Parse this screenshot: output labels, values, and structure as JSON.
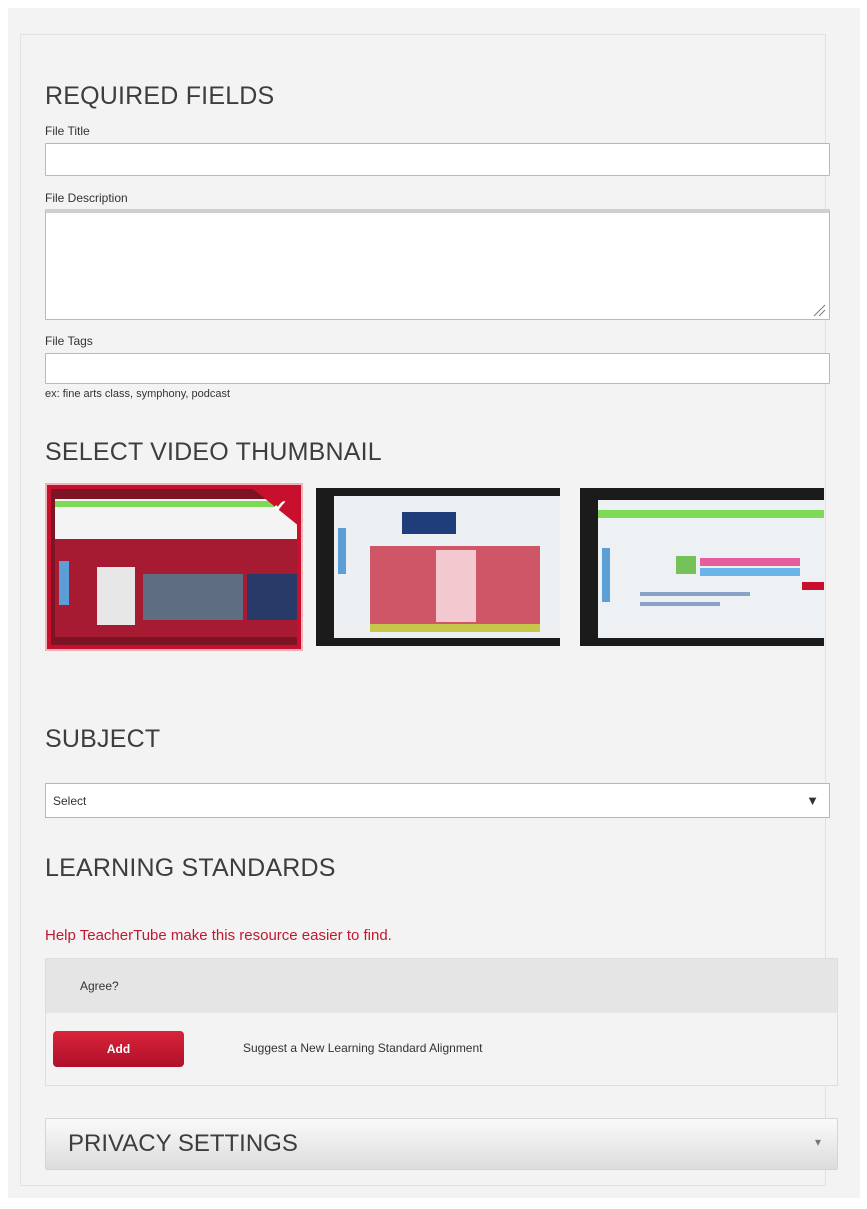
{
  "required_fields": {
    "title": "REQUIRED FIELDS",
    "file_title_label": "File Title",
    "file_title_value": "",
    "file_description_label": "File Description",
    "file_description_value": "",
    "file_tags_label": "File Tags",
    "file_tags_value": "",
    "file_tags_hint": "ex: fine arts class, symphony, podcast"
  },
  "thumbnails": {
    "title": "SELECT VIDEO THUMBNAIL",
    "items": [
      {
        "selected": true,
        "checkmark": "✔"
      },
      {
        "selected": false
      },
      {
        "selected": false
      }
    ]
  },
  "subject": {
    "title": "SUBJECT",
    "selected_option": "Select",
    "arrow": "▼"
  },
  "learning_standards": {
    "title": "LEARNING STANDARDS",
    "help_text": "Help TeacherTube make this resource easier to find.",
    "agree_label": "Agree?",
    "add_button": "Add",
    "suggest_text": "Suggest a New Learning Standard Alignment"
  },
  "privacy": {
    "title": "PRIVACY SETTINGS",
    "caret": "▾"
  },
  "colors": {
    "accent_red": "#c0182e",
    "panel_bg": "#f3f3f3"
  }
}
